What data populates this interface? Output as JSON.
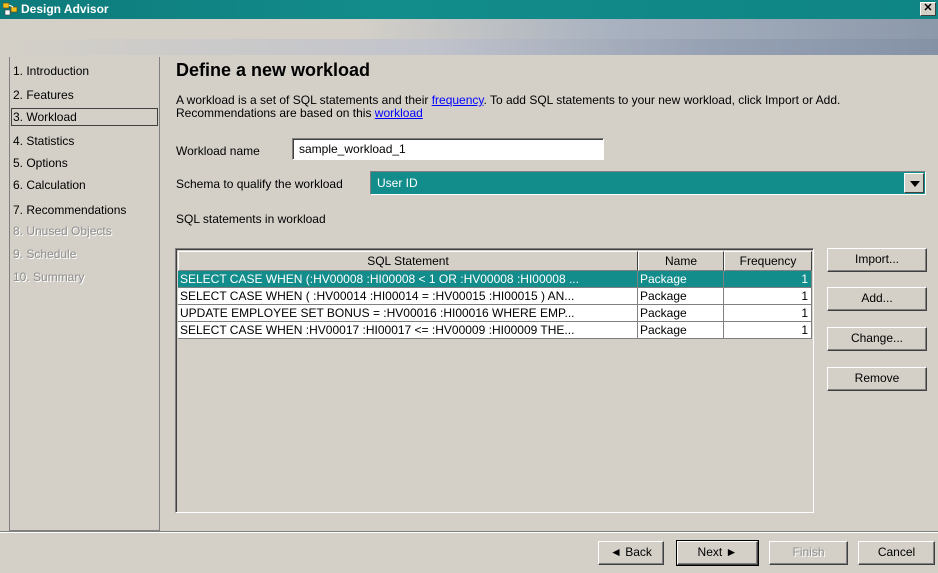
{
  "window": {
    "title": "Design Advisor",
    "close_glyph": "✕"
  },
  "nav": {
    "items": [
      {
        "label": "1. Introduction",
        "state": "normal"
      },
      {
        "label": "2. Features",
        "state": "normal"
      },
      {
        "label": "3. Workload",
        "state": "selected"
      },
      {
        "label": "4. Statistics",
        "state": "normal"
      },
      {
        "label": "5. Options",
        "state": "normal"
      },
      {
        "label": "6. Calculation",
        "state": "normal"
      },
      {
        "label": "7. Recommendations",
        "state": "normal"
      },
      {
        "label": "8. Unused Objects",
        "state": "disabled"
      },
      {
        "label": "9. Schedule",
        "state": "disabled"
      },
      {
        "label": "10. Summary",
        "state": "disabled"
      }
    ]
  },
  "page": {
    "heading": "Define a new workload",
    "desc_part1": "A workload is a set of SQL statements and their ",
    "desc_link1": "frequency",
    "desc_part2": ". To add SQL statements to your new workload, click Import or Add.",
    "desc_part3": "Recommendations are based on this ",
    "desc_link2": "workload",
    "workload_name_label": "Workload name",
    "workload_name_value": "sample_workload_1",
    "schema_label": "Schema to qualify the workload",
    "schema_value": "User ID",
    "sql_statements_label": "SQL statements in workload"
  },
  "table": {
    "columns": [
      "SQL Statement",
      "Name",
      "Frequency"
    ],
    "rows": [
      {
        "sql": "SELECT CASE WHEN (:HV00008  :HI00008  < 1 OR :HV00008  :HI00008 ...",
        "name": "Package",
        "frequency": "1",
        "selected": true
      },
      {
        "sql": "SELECT CASE WHEN ( :HV00014  :HI00014  = :HV00015  :HI00015  ) AN...",
        "name": "Package",
        "frequency": "1",
        "selected": false
      },
      {
        "sql": "UPDATE EMPLOYEE SET BONUS = :HV00016  :HI00016  WHERE EMP...",
        "name": "Package",
        "frequency": "1",
        "selected": false
      },
      {
        "sql": "SELECT CASE WHEN :HV00017  :HI00017  <= :HV00009  :HI00009  THE...",
        "name": "Package",
        "frequency": "1",
        "selected": false
      }
    ]
  },
  "side_buttons": {
    "import": "Import...",
    "add": "Add...",
    "change": "Change...",
    "remove": "Remove"
  },
  "footer_buttons": {
    "back": "◄ Back",
    "next": "Next ►",
    "finish": "Finish",
    "cancel": "Cancel"
  },
  "colors": {
    "accent": "#138c8c",
    "link": "#0000ff",
    "dialog_bg": "#d4d0c8"
  }
}
